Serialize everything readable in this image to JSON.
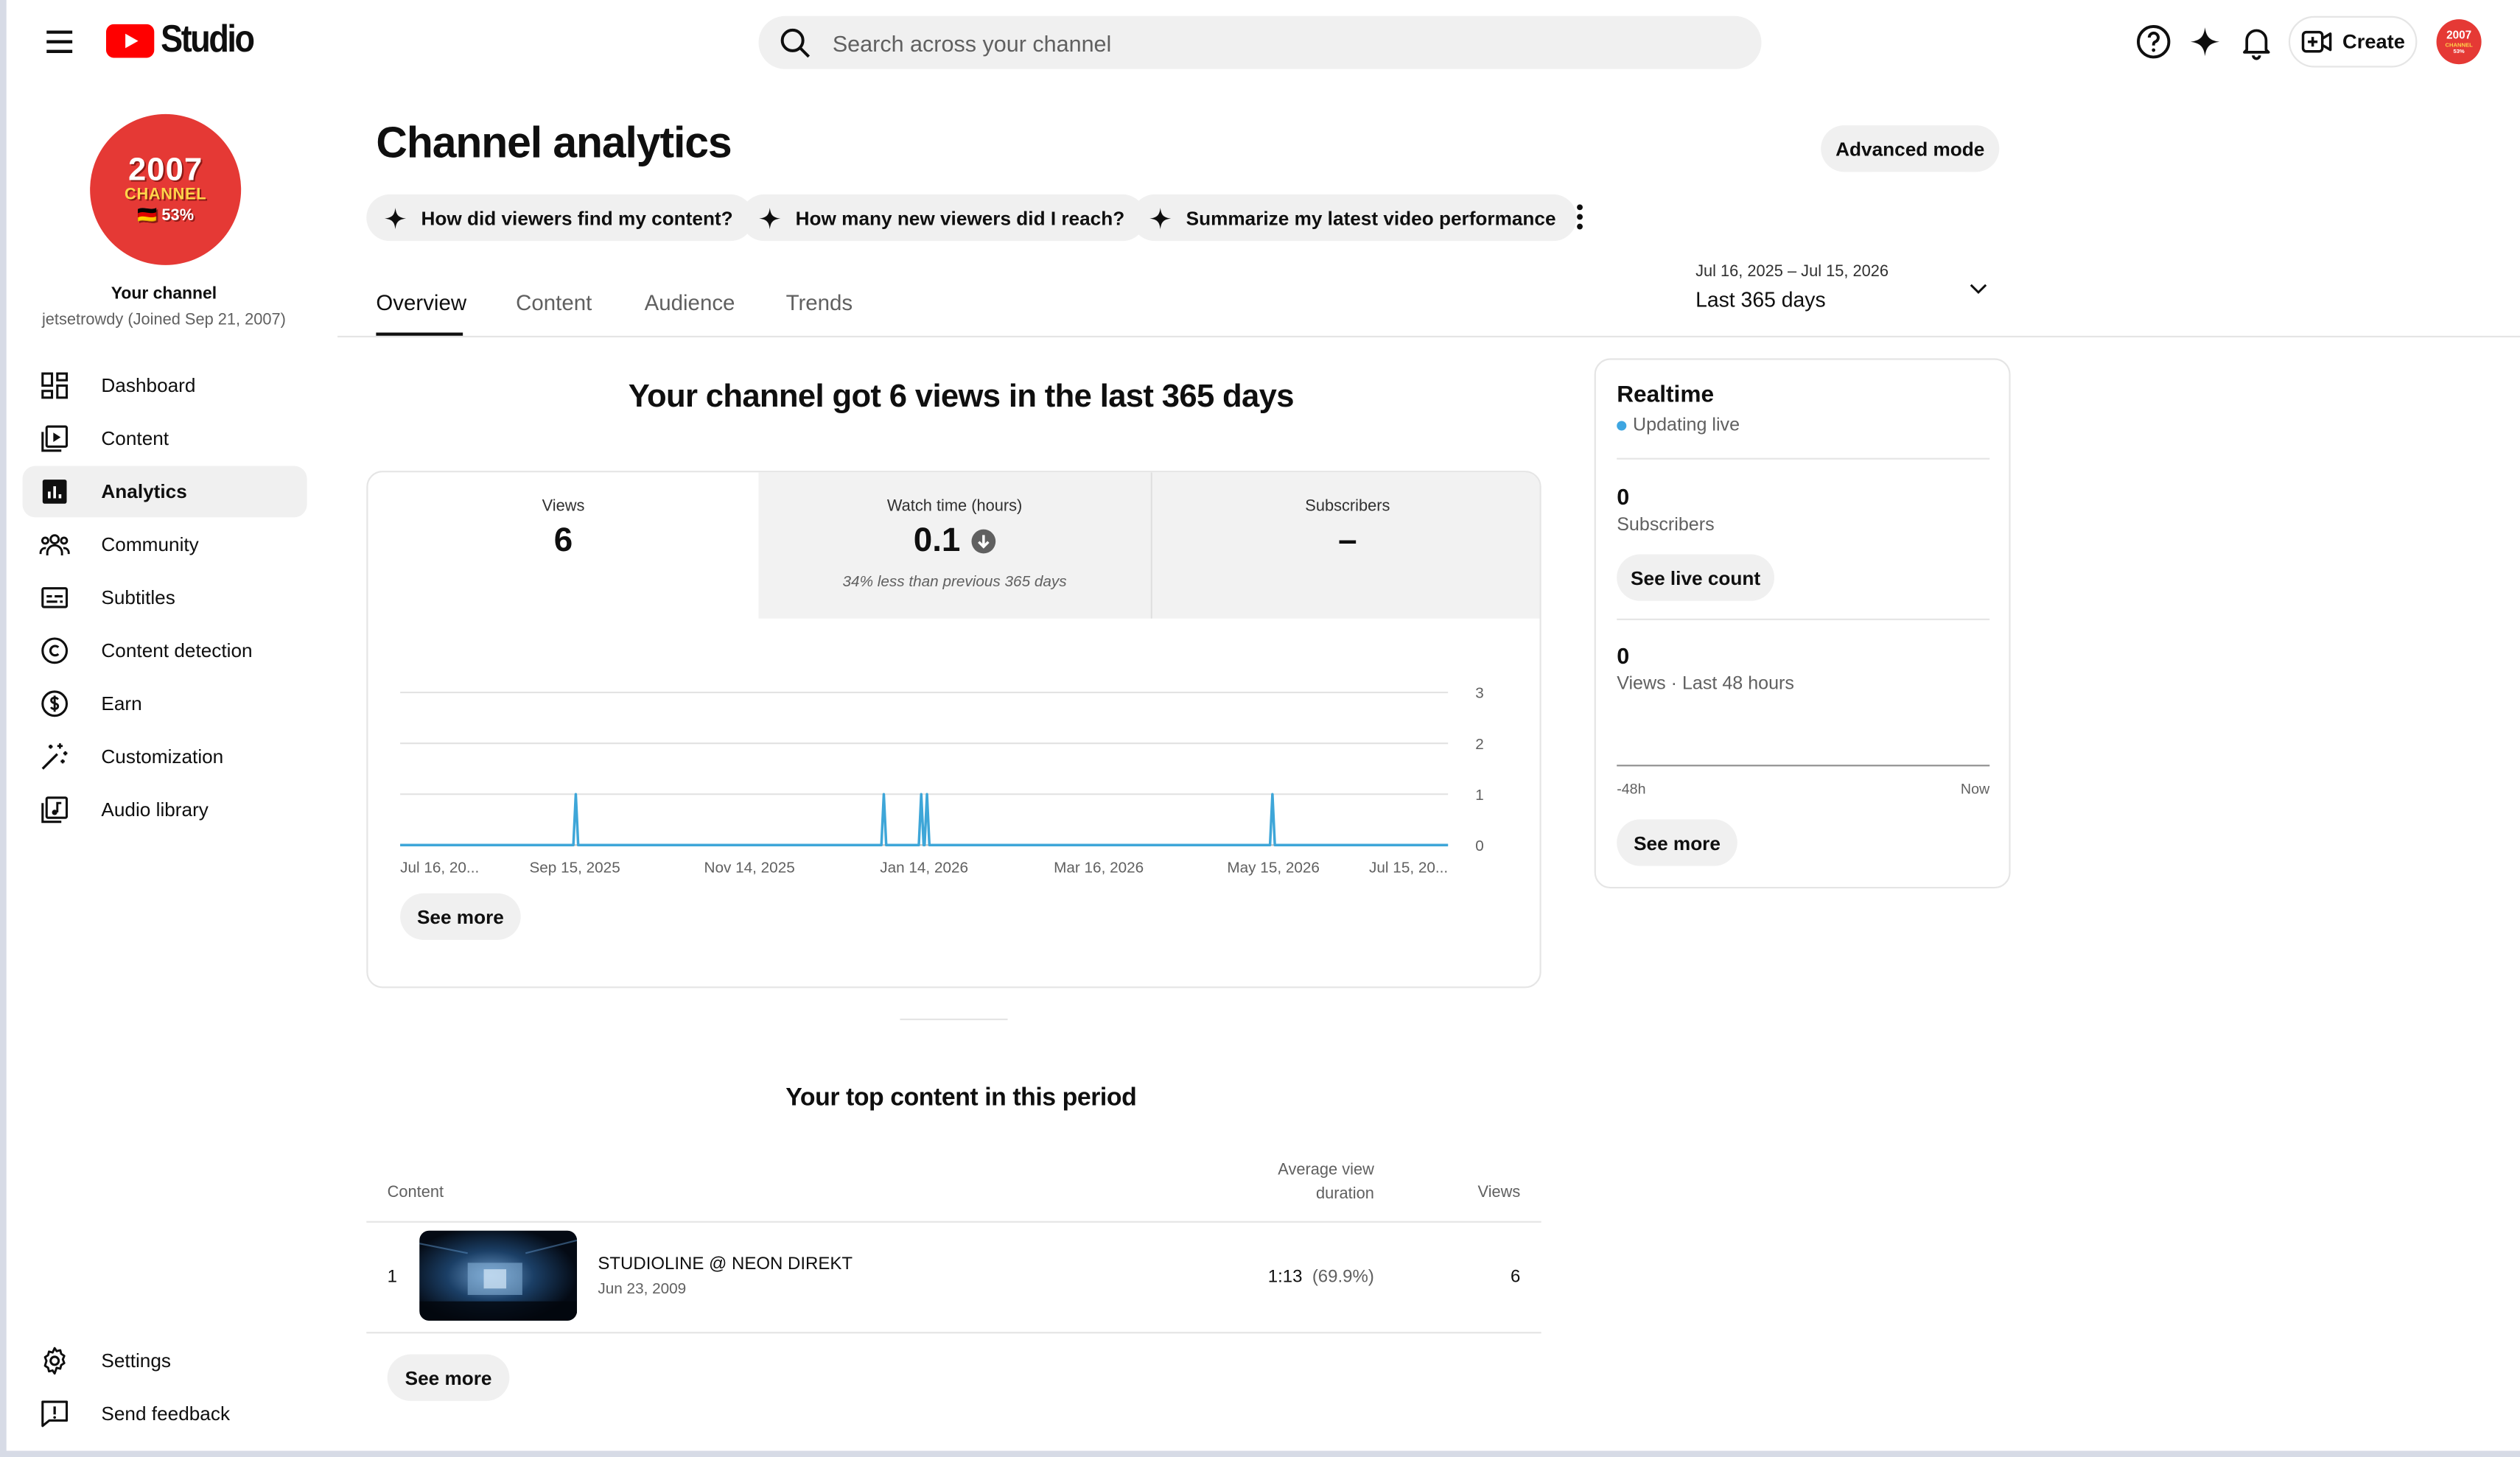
{
  "app": {
    "logo_text": "Studio",
    "search_placeholder": "Search across your channel",
    "create_label": "Create",
    "avatar_lines": [
      "2007",
      "CHANNEL",
      "53%"
    ]
  },
  "sidebar": {
    "channel_avatar_lines": [
      "2007",
      "CHANNEL",
      "🇩🇪 53%"
    ],
    "your_channel": "Your channel",
    "channel_sub": "jetsetrowdy (Joined Sep 21, 2007)",
    "items": [
      {
        "label": "Dashboard",
        "icon": "dashboard-icon"
      },
      {
        "label": "Content",
        "icon": "content-icon"
      },
      {
        "label": "Analytics",
        "icon": "analytics-icon",
        "active": true
      },
      {
        "label": "Community",
        "icon": "community-icon"
      },
      {
        "label": "Subtitles",
        "icon": "subtitles-icon"
      },
      {
        "label": "Content detection",
        "icon": "copyright-icon"
      },
      {
        "label": "Earn",
        "icon": "dollar-icon"
      },
      {
        "label": "Customization",
        "icon": "magic-wand-icon"
      },
      {
        "label": "Audio library",
        "icon": "audio-library-icon"
      }
    ],
    "bottom_items": [
      {
        "label": "Settings",
        "icon": "gear-icon"
      },
      {
        "label": "Send feedback",
        "icon": "feedback-icon"
      }
    ]
  },
  "main": {
    "title": "Channel analytics",
    "advanced_mode": "Advanced mode",
    "chips": [
      "How did viewers find my content?",
      "How many new viewers did I reach?",
      "Summarize my latest video performance"
    ],
    "tabs": [
      "Overview",
      "Content",
      "Audience",
      "Trends"
    ],
    "active_tab": "Overview",
    "date_range": {
      "range": "Jul 16, 2025 – Jul 15, 2026",
      "label": "Last 365 days"
    },
    "headline": "Your channel got 6 views in the last 365 days",
    "metrics": [
      {
        "label": "Views",
        "value": "6",
        "note": ""
      },
      {
        "label": "Watch time (hours)",
        "value": "0.1",
        "note": "34% less than previous 365 days"
      },
      {
        "label": "Subscribers",
        "value": "–",
        "note": ""
      }
    ],
    "see_more": "See more",
    "top_content": {
      "title": "Your top content in this period",
      "headers": {
        "content": "Content",
        "avg_line1": "Average view",
        "avg_line2": "duration",
        "views": "Views"
      },
      "rows": [
        {
          "rank": "1",
          "title": "STUDIOLINE @ NEON DIREKT",
          "date": "Jun 23, 2009",
          "avg": "1:13",
          "pct": "(69.9%)",
          "views": "6"
        }
      ],
      "see_more": "See more"
    }
  },
  "realtime": {
    "title": "Realtime",
    "live": "Updating live",
    "subs_value": "0",
    "subs_label": "Subscribers",
    "see_live_count": "See live count",
    "views_value": "0",
    "views_label": "Views · Last 48 hours",
    "tick_left": "-48h",
    "tick_right": "Now",
    "see_more": "See more"
  },
  "colors": {
    "line": "#3ea6d8",
    "brand_red": "#ff0000",
    "avatar_red": "#e53935",
    "live_dot": "#3ea6e1"
  },
  "chart_data": {
    "type": "line",
    "title": "",
    "xlabel": "",
    "ylabel": "",
    "x_tick_labels": [
      "Jul 16, 20...",
      "Sep 15, 2025",
      "Nov 14, 2025",
      "Jan 14, 2026",
      "Mar 16, 2026",
      "May 15, 2026",
      "Jul 15, 20..."
    ],
    "y_ticks": [
      0,
      1,
      2,
      3
    ],
    "ylim": [
      0,
      3
    ],
    "x_range": [
      "2025-07-16",
      "2026-07-15"
    ],
    "series": [
      {
        "name": "",
        "points": [
          {
            "x": "2025-09-15",
            "y": 1
          },
          {
            "x": "2025-12-31",
            "y": 1
          },
          {
            "x": "2026-01-13",
            "y": 1
          },
          {
            "x": "2026-01-15",
            "y": 1
          },
          {
            "x": "2026-05-15",
            "y": 1
          }
        ],
        "baseline": 0
      }
    ],
    "grid": true
  }
}
